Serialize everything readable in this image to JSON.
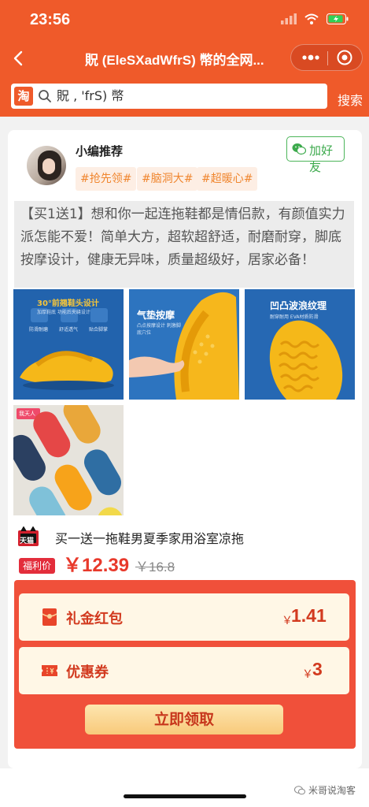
{
  "status_bar": {
    "time": "23:56"
  },
  "nav": {
    "title": "貺 (EleSXadWfrS) 幣的全网..."
  },
  "search": {
    "value": "貺 ,                  'frS) 幣",
    "button_label": "搜索",
    "logo_text": "淘"
  },
  "recommend": {
    "editor_label": "小编推荐",
    "add_friend_label": "加好友",
    "tags": [
      "#抢先领#",
      "#脑洞大#",
      "#超暖心#"
    ],
    "description": "【买1送1】想和你一起连拖鞋都是情侣款，有颜值实力派怎能不爱！简单大方，超软超舒适，耐磨耐穿，脚底按摩设计，健康无异味，质量超级好，居家必备！"
  },
  "images": [
    {
      "caption": "30°前翘鞋头设计",
      "sub": "加厚鞋底 功能后夹缝设计",
      "features": [
        "防滑耐磨",
        "舒适透气",
        "贴合脚掌"
      ]
    },
    {
      "caption": "气垫按摩",
      "sub": "凸点按摩设计 刺激脚底穴位"
    },
    {
      "caption": "凹凸波浪纹理",
      "sub": "耐穿耐用 EVA材质防滑"
    },
    {
      "caption": "我天人"
    }
  ],
  "product": {
    "tmall_label": "天猫",
    "title": "买一送一拖鞋男夏季家用浴室凉拖",
    "price_badge": "福利价",
    "price": "￥12.39",
    "original_price": "￥16.8"
  },
  "promo": {
    "red_packet_label": "礼金红包",
    "red_packet_yen": "￥",
    "red_packet_amount": "1.41",
    "coupon_label": "优惠券",
    "coupon_yen": "￥",
    "coupon_amount": "3",
    "claim_label": "立即领取"
  },
  "watermark": "米哥说淘客"
}
